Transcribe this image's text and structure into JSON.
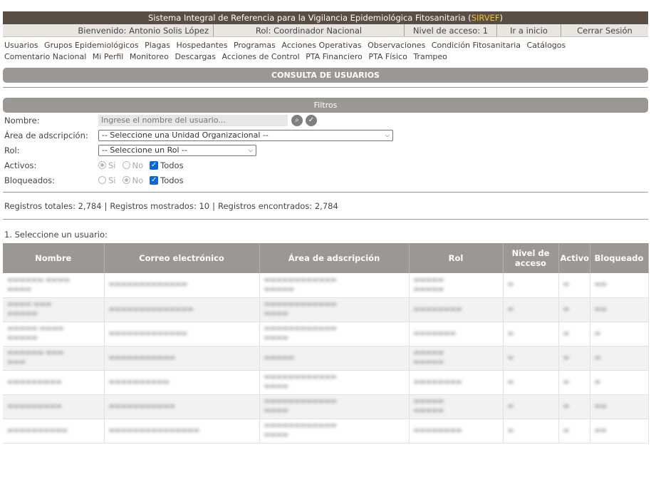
{
  "header": {
    "title_prefix": "Sistema Integral de Referencia para la Vigilancia Epidemiológica Fitosanitaria (",
    "acronym": "SIRVEF",
    "title_suffix": ")",
    "welcome": "Bienvenido: Antonio Solis López",
    "role": "Rol: Coordinador Nacional",
    "access_level": "Nivel de acceso: 1",
    "home_link": "Ir a inicio",
    "logout_link": "Cerrar Sesión"
  },
  "menu": {
    "row1": [
      "Usuarios",
      "Grupos Epidemiológicos",
      "Plagas",
      "Hospedantes",
      "Programas",
      "Acciones Operativas",
      "Observaciones",
      "Condición Fitosanitaria",
      "Catálogos"
    ],
    "row2": [
      "Comentario Nacional",
      "Mi Perfil",
      "Monitoreo",
      "Descargas",
      "Acciones de Control",
      "PTA Financiero",
      "PTA Físico",
      "Trampeo"
    ]
  },
  "section_title": "CONSULTA DE USUARIOS",
  "filters": {
    "title": "Filtros",
    "name_label": "Nombre:",
    "name_placeholder": "Ingrese el nombre del usuario...",
    "area_label": "Área de adscripción:",
    "area_selected": "-- Seleccione una Unidad Organizacional --",
    "role_label": "Rol:",
    "role_selected": "-- Seleccione un Rol --",
    "active_label": "Activos:",
    "blocked_label": "Bloqueados:",
    "opt_si": "Si",
    "opt_no": "No",
    "opt_todos": "Todos"
  },
  "stats": {
    "total": "Registros totales: 2,784",
    "shown": "Registros mostrados:  10",
    "found": "Registros encontrados:  2,784"
  },
  "prompt": "1. Seleccione un usuario:",
  "table": {
    "headers": {
      "nombre": "Nombre",
      "correo": "Correo electrónico",
      "area": "Área de adscripción",
      "rol": "Rol",
      "nivel": "Nivel de acceso",
      "activo": "Activo",
      "bloqueado": "Bloqueado"
    }
  },
  "colors": {
    "title_bg": "#5a4e44",
    "acronym": "#f2c230",
    "section_bg": "#9b9793",
    "checkbox": "#0a65d6"
  }
}
